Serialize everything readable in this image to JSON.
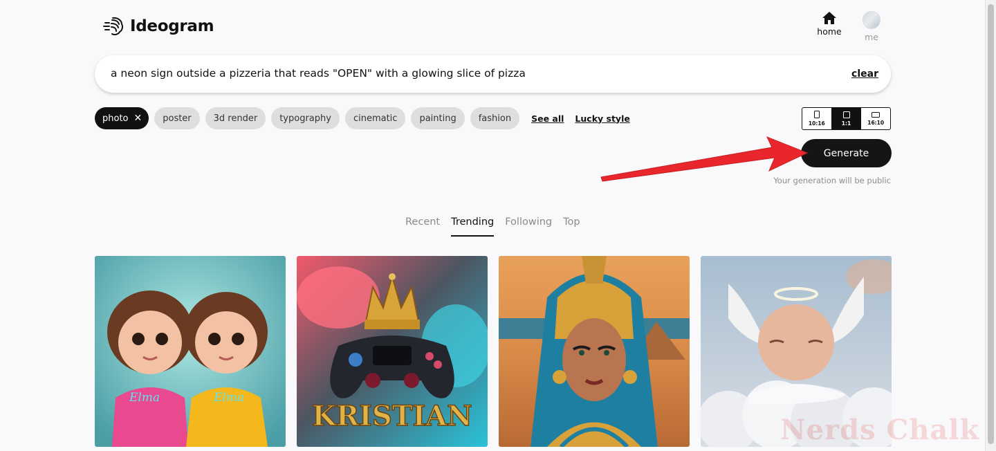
{
  "header": {
    "logo_text": "Ideogram",
    "nav": [
      {
        "label": "home",
        "icon": "home-icon"
      },
      {
        "label": "me",
        "icon": "avatar"
      }
    ]
  },
  "prompt": {
    "value": "a neon sign outside a pizzeria that reads \"OPEN\" with a glowing slice of pizza",
    "clear_label": "clear"
  },
  "styles": {
    "chips": [
      {
        "label": "photo",
        "active": true
      },
      {
        "label": "poster"
      },
      {
        "label": "3d render"
      },
      {
        "label": "typography"
      },
      {
        "label": "cinematic"
      },
      {
        "label": "painting"
      },
      {
        "label": "fashion"
      }
    ],
    "see_all": "See all",
    "lucky_style": "Lucky style"
  },
  "aspect_ratios": [
    {
      "label": "10:16"
    },
    {
      "label": "1:1",
      "selected": true
    },
    {
      "label": "16:10"
    }
  ],
  "generate": {
    "label": "Generate",
    "note": "Your generation will be public"
  },
  "feed_tabs": [
    {
      "label": "Recent"
    },
    {
      "label": "Trending",
      "active": true
    },
    {
      "label": "Following"
    },
    {
      "label": "Top"
    }
  ],
  "gallery": [
    {
      "subject": "two toddler girls in hoodies",
      "hoodie_text": "Elma"
    },
    {
      "subject": "game controller with crown",
      "text": "KRISTIAN"
    },
    {
      "subject": "egyptian queen portrait"
    },
    {
      "subject": "sleeping baby angel on clouds"
    }
  ],
  "watermark": "Nerds Chalk",
  "colors": {
    "accent": "#111111",
    "annotation_arrow": "#e8262b",
    "chip_bg": "#dedede"
  }
}
